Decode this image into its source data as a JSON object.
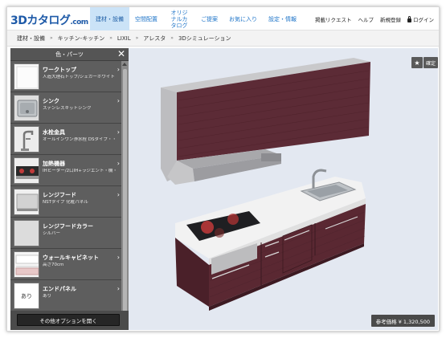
{
  "header": {
    "logo_main": "3Dカタログ",
    "logo_domain": ".com",
    "tabs": [
      {
        "label": "建材・設備",
        "active": true
      },
      {
        "label": "空間配置",
        "active": false
      },
      {
        "label": "オリジナルカタログ",
        "active": false
      },
      {
        "label": "ご提案",
        "active": false
      },
      {
        "label": "お気に入り",
        "active": false
      },
      {
        "label": "設定・情報",
        "active": false
      }
    ],
    "right_links": [
      "掲載リクエスト",
      "ヘルプ",
      "新規登録"
    ],
    "login": "ログイン"
  },
  "breadcrumb": [
    "建材・設備",
    "キッチン-キッチン",
    "LIXIL",
    "アレスタ",
    "3Dシミュレーション"
  ],
  "breadcrumb_separator": "»",
  "sidebar": {
    "title": "色・パーツ",
    "close_glyph": "✕",
    "items": [
      {
        "title": "ワークトップ",
        "sub": "人造大理石トップ/シェガーホワイト",
        "icon": "worktop-icon"
      },
      {
        "title": "シンク",
        "sub": "ステンレスキットシンク",
        "icon": "sink-icon"
      },
      {
        "title": "水栓金具",
        "sub": "オールインワン浄水栓 DSタイプ・・・",
        "icon": "faucet-icon"
      },
      {
        "title": "加熱機器",
        "sub": "IHヒーター/2口IH+ラジエント・機・・・",
        "icon": "cooktop-icon"
      },
      {
        "title": "レンジフード",
        "sub": "NSTタイプ 化粧パネル",
        "icon": "rangehood-icon"
      },
      {
        "title": "レンジフードカラー",
        "sub": "シルバー",
        "icon": "color-swatch-icon"
      },
      {
        "title": "ウォールキャビネット",
        "sub": "高さ70cm",
        "icon": "wall-cabinet-icon"
      },
      {
        "title": "エンドパネル",
        "sub": "あり",
        "icon": "end-panel-icon",
        "thumb_text": "あり"
      }
    ],
    "footer_button": "その他オプションを開く"
  },
  "view": {
    "star_glyph": "★",
    "fix_label": "確定",
    "price_label": "参考価格 ¥ 1,320,500"
  },
  "colors": {
    "cabinet": "#5a2a34",
    "panel_gray": "#b9b9bc",
    "view_bg": "#e3e8f1",
    "accent": "#1e74c8"
  }
}
